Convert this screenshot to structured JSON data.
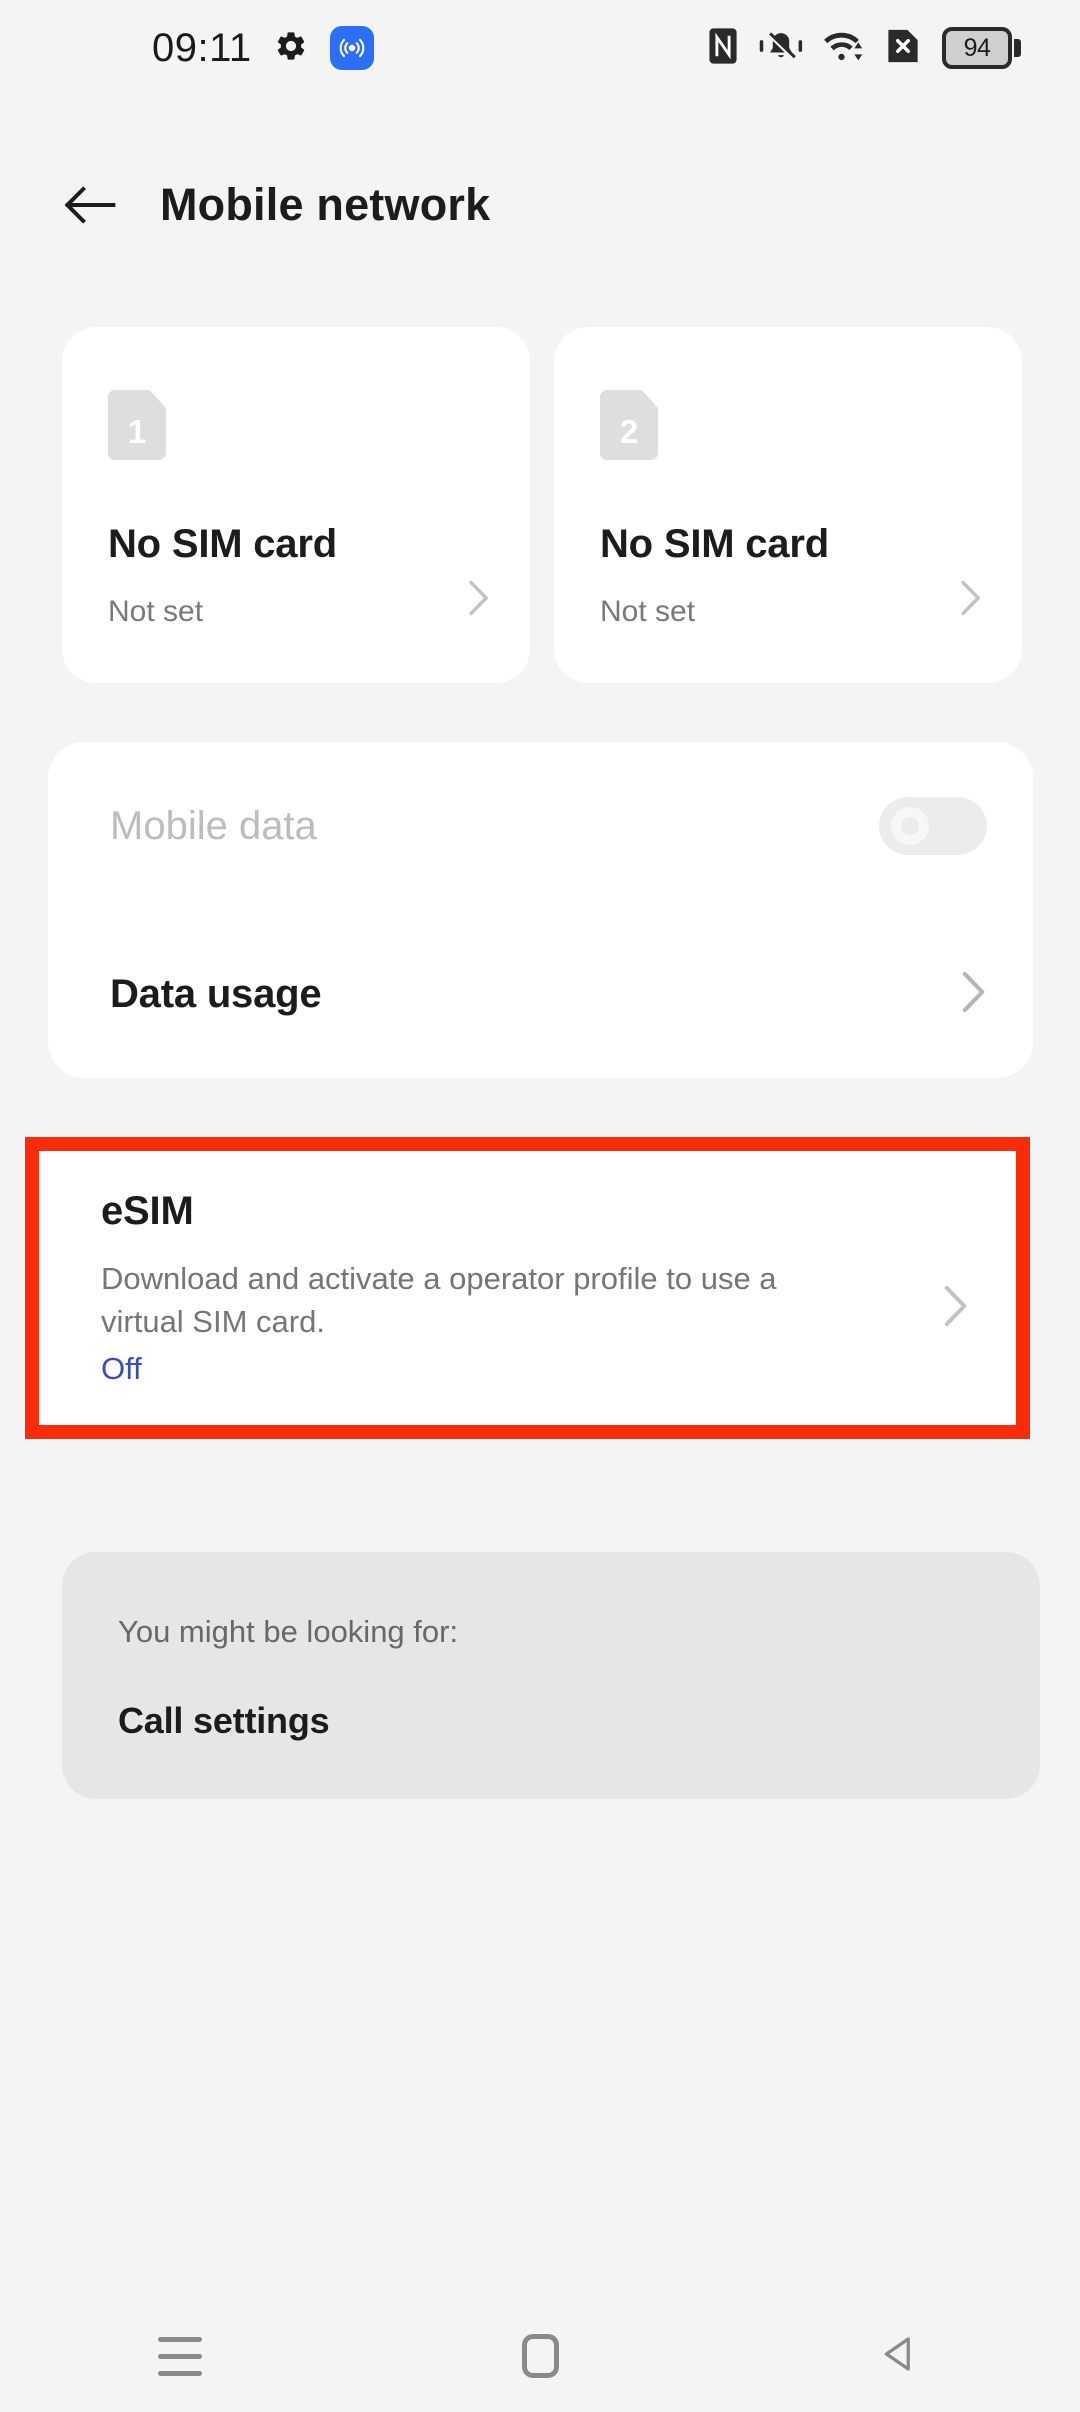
{
  "statusbar": {
    "time": "09:11",
    "left_icons": [
      {
        "name": "gear-icon"
      },
      {
        "name": "hotspot-icon"
      }
    ],
    "right_icons": [
      {
        "name": "nfc-icon"
      },
      {
        "name": "vibrate-mute-icon"
      },
      {
        "name": "wifi-icon"
      },
      {
        "name": "no-sim-icon"
      }
    ],
    "battery_level": "94"
  },
  "header": {
    "back_icon": "back-arrow-icon",
    "title": "Mobile network"
  },
  "sim_cards": [
    {
      "slot": "1",
      "title": "No SIM card",
      "subtitle": "Not set",
      "chevron": "chevron-right-icon"
    },
    {
      "slot": "2",
      "title": "No SIM card",
      "subtitle": "Not set",
      "chevron": "chevron-right-icon"
    }
  ],
  "data_card": {
    "mobile_data": {
      "label": "Mobile data",
      "enabled": false,
      "toggle_state": "off"
    },
    "data_usage": {
      "label": "Data usage",
      "chevron": "chevron-right-icon"
    }
  },
  "esim": {
    "title": "eSIM",
    "description": "Download and activate a operator profile to use a virtual SIM card.",
    "state": "Off",
    "chevron": "chevron-right-icon",
    "highlight_color": "#f92c0a",
    "state_color": "#3b4bbd"
  },
  "suggestions": {
    "label": "You might be looking for:",
    "items": [
      {
        "label": "Call settings"
      }
    ]
  },
  "navbar": {
    "recents": "recents-icon",
    "home": "home-icon",
    "back": "back-triangle-icon"
  },
  "colors": {
    "background": "#f4f4f4",
    "card": "#ffffff",
    "suggest_card": "#e6e6e6",
    "text_primary": "#1c1c1c",
    "text_secondary": "#757575",
    "text_disabled": "#bcbcbc",
    "accent_blue": "#2c6ef5"
  }
}
